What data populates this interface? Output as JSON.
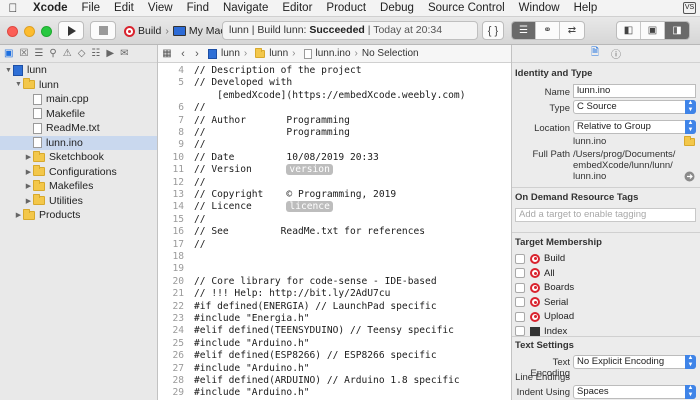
{
  "menubar": {
    "app": "Xcode",
    "items": [
      "File",
      "Edit",
      "View",
      "Find",
      "Navigate",
      "Editor",
      "Product",
      "Debug",
      "Source Control",
      "Window",
      "Help"
    ],
    "badge": "VS"
  },
  "toolbar": {
    "scheme_target": "Build",
    "scheme_device": "My Mac",
    "activity_prefix": "lunn | Build lunn: ",
    "activity_status": "Succeeded",
    "activity_time": " | Today at 20:34"
  },
  "navigator": {
    "items": [
      {
        "label": "lunn",
        "kind": "project",
        "indent": 0,
        "disclosure": "▼"
      },
      {
        "label": "lunn",
        "kind": "folder",
        "indent": 1,
        "disclosure": "▼"
      },
      {
        "label": "main.cpp",
        "kind": "file",
        "indent": 2,
        "disclosure": ""
      },
      {
        "label": "Makefile",
        "kind": "file",
        "indent": 2,
        "disclosure": ""
      },
      {
        "label": "ReadMe.txt",
        "kind": "file",
        "indent": 2,
        "disclosure": ""
      },
      {
        "label": "lunn.ino",
        "kind": "file",
        "indent": 2,
        "disclosure": "",
        "selected": true
      },
      {
        "label": "Sketchbook",
        "kind": "folder",
        "indent": 2,
        "disclosure": "▶"
      },
      {
        "label": "Configurations",
        "kind": "folder",
        "indent": 2,
        "disclosure": "▶"
      },
      {
        "label": "Makefiles",
        "kind": "folder",
        "indent": 2,
        "disclosure": "▶"
      },
      {
        "label": "Utilities",
        "kind": "folder",
        "indent": 2,
        "disclosure": "▶"
      },
      {
        "label": "Products",
        "kind": "folder",
        "indent": 1,
        "disclosure": "▶"
      }
    ]
  },
  "jumpbar": {
    "crumb1": "lunn",
    "crumb2": "lunn",
    "crumb3": "lunn.ino",
    "crumb4": "No Selection"
  },
  "code": [
    {
      "n": "4",
      "t": "// Description of the project"
    },
    {
      "n": "5",
      "t": "// Developed with"
    },
    {
      "n": "",
      "t": "    [embedXcode](https://embedXcode.weebly.com)"
    },
    {
      "n": "6",
      "t": "//"
    },
    {
      "n": "7",
      "t": "// Author       Programming"
    },
    {
      "n": "8",
      "t": "//              Programming"
    },
    {
      "n": "9",
      "t": "//"
    },
    {
      "n": "10",
      "t": "// Date         10/08/2019 20:33"
    },
    {
      "n": "11",
      "t": "// Version      ",
      "pill": "version"
    },
    {
      "n": "12",
      "t": "//"
    },
    {
      "n": "13",
      "t": "// Copyright    © Programming, 2019"
    },
    {
      "n": "14",
      "t": "// Licence      ",
      "pill": "licence"
    },
    {
      "n": "15",
      "t": "//"
    },
    {
      "n": "16",
      "t": "// See         ReadMe.txt for references"
    },
    {
      "n": "17",
      "t": "//"
    },
    {
      "n": "18",
      "t": ""
    },
    {
      "n": "19",
      "t": ""
    },
    {
      "n": "20",
      "t": "// Core library for code-sense - IDE-based"
    },
    {
      "n": "21",
      "t": "// !!! Help: http://bit.ly/2AdU7cu"
    },
    {
      "n": "22",
      "t": "#if defined(ENERGIA) // LaunchPad specific"
    },
    {
      "n": "23",
      "t": "#include \"Energia.h\""
    },
    {
      "n": "24",
      "t": "#elif defined(TEENSYDUINO) // Teensy specific"
    },
    {
      "n": "25",
      "t": "#include \"Arduino.h\""
    },
    {
      "n": "26",
      "t": "#elif defined(ESP8266) // ESP8266 specific"
    },
    {
      "n": "27",
      "t": "#include \"Arduino.h\""
    },
    {
      "n": "28",
      "t": "#elif defined(ARDUINO) // Arduino 1.8 specific"
    },
    {
      "n": "29",
      "t": "#include \"Arduino.h\""
    }
  ],
  "inspector": {
    "identity_title": "Identity and Type",
    "name_label": "Name",
    "name_value": "lunn.ino",
    "type_label": "Type",
    "type_value": "C Source",
    "location_label": "Location",
    "location_value": "Relative to Group",
    "location_file": "lunn.ino",
    "fullpath_label": "Full Path",
    "fullpath_l1": "/Users/prog/Documents/",
    "fullpath_l2": "embedXcode/lunn/lunn/",
    "fullpath_l3": "lunn.ino",
    "odr_title": "On Demand Resource Tags",
    "odr_placeholder": "Add a target to enable tagging",
    "membership_title": "Target Membership",
    "members": [
      "Build",
      "All",
      "Boards",
      "Serial",
      "Upload",
      "Index"
    ],
    "text_settings_title": "Text Settings",
    "encoding_label": "Text Encoding",
    "encoding_value": "No Explicit Encoding",
    "line_endings_label": "Line Endings",
    "indent_label": "Indent Using",
    "indent_value": "Spaces"
  }
}
